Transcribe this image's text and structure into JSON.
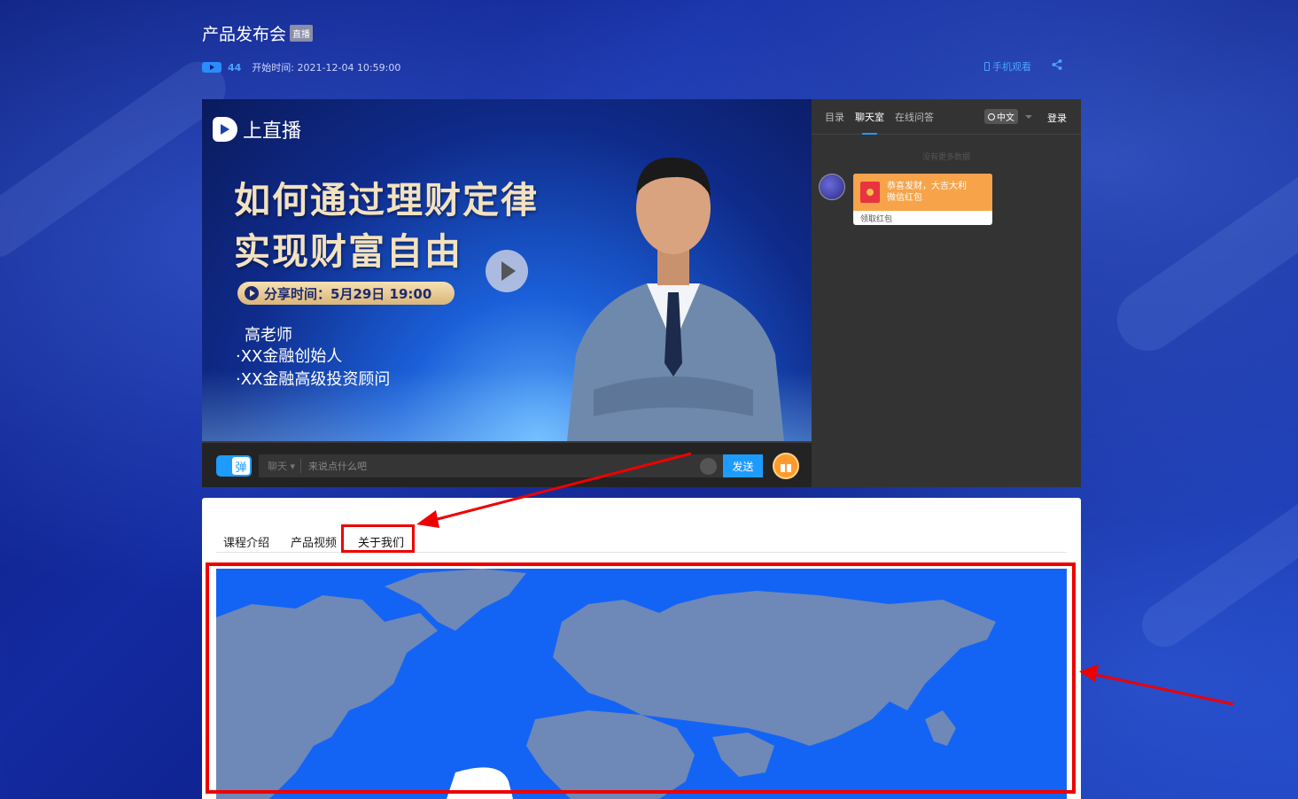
{
  "header": {
    "title": "产品发布会",
    "badge": "直播",
    "view_count": "44",
    "start_time": "开始时间: 2021-12-04 10:59:00",
    "mobile_watch": "手机观看"
  },
  "player": {
    "logo_text": "上直播",
    "headline_line1": "如何通过理财定律",
    "headline_line2": "实现财富自由",
    "share_time": "分享时间：5月29日 19:00",
    "teacher_name": "高老师",
    "bullets": [
      "·XX金融创始人",
      "·XX金融高级投资顾问"
    ]
  },
  "controls": {
    "danmu_label": "弹",
    "chat_mode": "聊天",
    "input_placeholder": "来说点什么吧",
    "send_label": "发送"
  },
  "side": {
    "tabs": [
      "目录",
      "聊天室",
      "在线问答"
    ],
    "active_tab": "聊天室",
    "language": "中文",
    "login": "登录",
    "no_more": "没有更多数据",
    "message": {
      "text_line1": "恭喜发财，大吉大利",
      "text_line2": "微信红包",
      "action": "领取红包"
    }
  },
  "panel": {
    "tabs": [
      "课程介绍",
      "产品视频",
      "关于我们"
    ],
    "active_tab": "关于我们"
  },
  "colors": {
    "accent": "#1e9bff",
    "map_ocean": "#1364f5",
    "map_land": "#6e88b8",
    "highlight": "#e00000",
    "redpacket": "#f6a34a"
  }
}
